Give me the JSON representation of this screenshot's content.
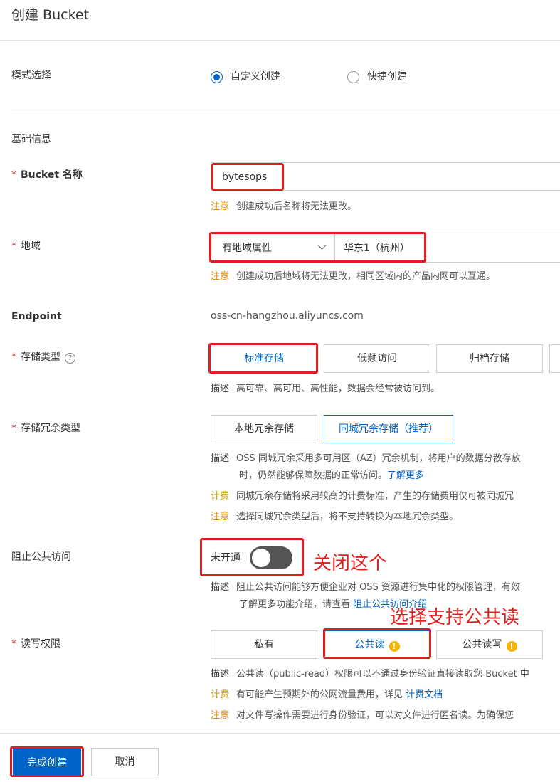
{
  "page": {
    "title": "创建 Bucket"
  },
  "mode": {
    "label": "模式选择",
    "options": [
      "自定义创建",
      "快捷创建"
    ],
    "selected": "自定义创建"
  },
  "basic_section": {
    "title": "基础信息"
  },
  "bucket_name": {
    "required": "*",
    "label": "Bucket 名称",
    "value": "bytesops",
    "hint_tag": "注意",
    "hint": "创建成功后名称将无法更改。"
  },
  "region": {
    "required": "*",
    "label": "地域",
    "type_value": "有地域属性",
    "region_value": "华东1（杭州）",
    "hint_tag": "注意",
    "hint": "创建成功后地域将无法更改，相同区域内的产品内网可以互通。"
  },
  "endpoint": {
    "label": "Endpoint",
    "value": "oss-cn-hangzhou.aliyuncs.com"
  },
  "storage_class": {
    "required": "*",
    "label": "存储类型",
    "help_icon": "?",
    "options": [
      "标准存储",
      "低频访问",
      "归档存储"
    ],
    "selected": "标准存储",
    "desc_tag": "描述",
    "desc": "高可靠、高可用、高性能，数据会经常被访问到。"
  },
  "redundancy": {
    "required": "*",
    "label": "存储冗余类型",
    "options": [
      "本地冗余存储",
      "同城冗余存储（推荐）"
    ],
    "selected": "同城冗余存储（推荐）",
    "desc_tag": "描述",
    "desc_line1": "OSS 同城冗余采用多可用区（AZ）冗余机制，将用户的数据分散存放",
    "desc_line2": "时，仍然能够保障数据的正常访问。",
    "desc_link": "了解更多",
    "fee_tag": "计费",
    "fee": "同城冗余存储将采用较高的计费标准，产生的存储费用仅可被同城冗",
    "warn_tag": "注意",
    "warn": "选择同城冗余类型后，将不支持转换为本地冗余类型。"
  },
  "block_public": {
    "label": "阻止公共访问",
    "toggle_text": "未开通",
    "toggle_on": false,
    "desc_tag": "描述",
    "desc_line1": "阻止公共访问能够方便企业对 OSS 资源进行集中化的权限管理，有效",
    "desc_line2": "了解更多功能介绍，请查看",
    "desc_link": "阻止公共访问介绍"
  },
  "acl": {
    "required": "*",
    "label": "读写权限",
    "options": [
      "私有",
      "公共读",
      "公共读写"
    ],
    "selected": "公共读",
    "warn_icon": "!",
    "desc_tag": "描述",
    "desc": "公共读（public-read）权限可以不通过身份验证直接读取您 Bucket 中",
    "fee_tag": "计费",
    "fee": "有可能产生预期外的公网流量费用，详见",
    "fee_link": "计费文档",
    "warn_tag": "注意",
    "warn": "对文件写操作需要进行身份验证，可以对文件进行匿名读。为确保您"
  },
  "annotations": {
    "close_this": "关闭这个",
    "choose_public_read": "选择支持公共读"
  },
  "footer": {
    "confirm": "完成创建",
    "cancel": "取消"
  },
  "colors": {
    "accent": "#0064c8",
    "annotation": "#e02020",
    "warning": "#e08a00"
  }
}
